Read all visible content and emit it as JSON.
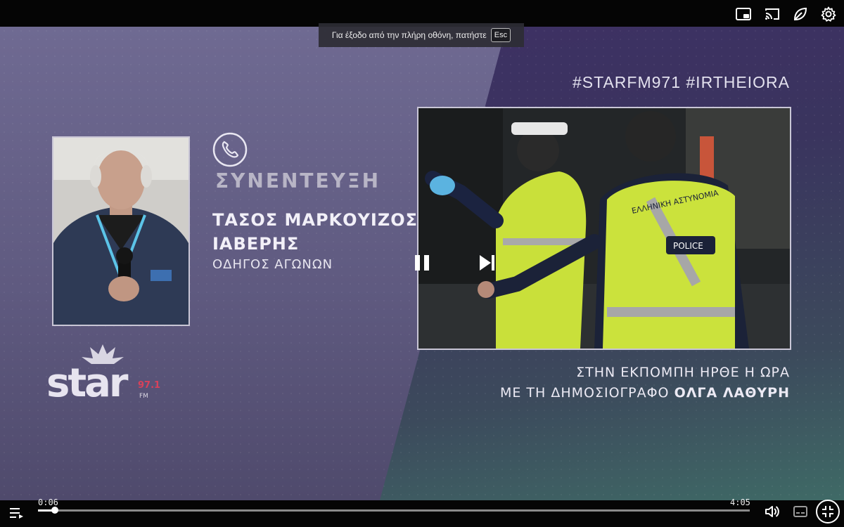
{
  "toast": {
    "message": "Για έξοδο από την πλήρη οθόνη, πατήστε",
    "key": "Esc"
  },
  "overlay": {
    "hashtag": "#STARFM971 #IRTHEIORA",
    "interview_label": "ΣΥΝΕΝΤΕΥΞΗ",
    "guest_name_line1": "ΤΑΣΟΣ ΜΑΡΚΟΥΙΖΟΣ",
    "guest_name_line2": "ΙΑΒΕΡΗΣ",
    "guest_role": "ΟΔΗΓΟΣ ΑΓΩΝΩΝ",
    "promo_line1": "ΣΤΗΝ ΕΚΠΟΜΠΗ ΗΡΘΕ Η ΩΡΑ",
    "promo_line2_prefix": "ΜΕ ΤΗ ΔΗΜΟΣΙΟΓΡΑΦΟ",
    "promo_line2_name": "ΟΛΓΑ ΛΑΘΥΡΗ",
    "logo_text": "star",
    "logo_freq": "97.1",
    "logo_fm": "FM",
    "police_vest_text": "ΕΛΛΗΝΙΚΗ ΑΣΤΥΝΟΜΙΑ",
    "police_badge": "POLICE"
  },
  "player": {
    "current_time": "0:06",
    "duration": "4:05",
    "progress_percent": 2.4
  },
  "colors": {
    "accent": "#ffffff",
    "bar_bg": "#050505"
  }
}
